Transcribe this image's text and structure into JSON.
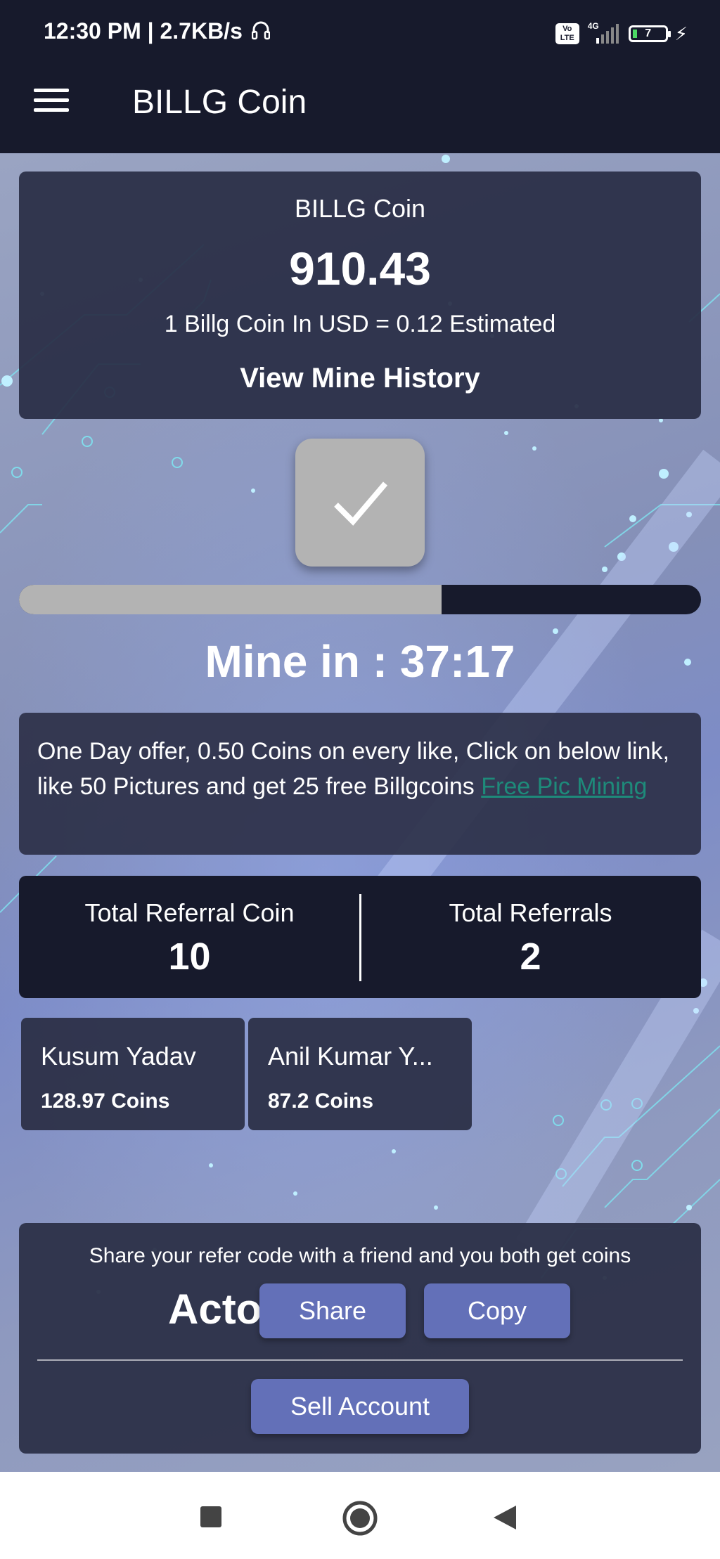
{
  "status_bar": {
    "time": "12:30 PM | 2.7KB/s",
    "volte": "Vo LTE",
    "network": "4G",
    "battery": "7"
  },
  "app_bar": {
    "title": "BILLG Coin"
  },
  "balance_card": {
    "title": "BILLG Coin",
    "balance": "910.43",
    "rate": "1 Billg Coin In USD = 0.12 Estimated",
    "history_link": "View Mine History"
  },
  "mining": {
    "progress_fraction": 0.62,
    "timer": "Mine in : 37:17"
  },
  "offer": {
    "text": "One Day offer, 0.50 Coins on every like, Click on below link, like 50 Pictures and get 25 free Billgcoins ",
    "link": "Free Pic Mining "
  },
  "referral_stats": {
    "coin_label": "Total Referral Coin",
    "coin_value": "10",
    "count_label": "Total Referrals",
    "count_value": "2"
  },
  "referrals": [
    {
      "name": "Kusum Yadav",
      "coins": "128.97 Coins"
    },
    {
      "name": "Anil Kumar  Y...",
      "coins": "87.2 Coins"
    }
  ],
  "share": {
    "message": "Share your refer code with a friend and you both get coins",
    "code": "Acto",
    "share_label": "Share",
    "copy_label": "Copy",
    "sell_label": "Sell Account"
  },
  "colors": {
    "dark_navy": "#171a2c",
    "card_bg": "#2c3048",
    "accent_button": "#6370b8",
    "link_teal": "#1e8a7a",
    "mine_button": "#b3b3b3"
  },
  "icons": [
    "headphone-icon",
    "menu-icon",
    "check-icon",
    "recent-apps-icon",
    "home-icon",
    "back-icon"
  ]
}
